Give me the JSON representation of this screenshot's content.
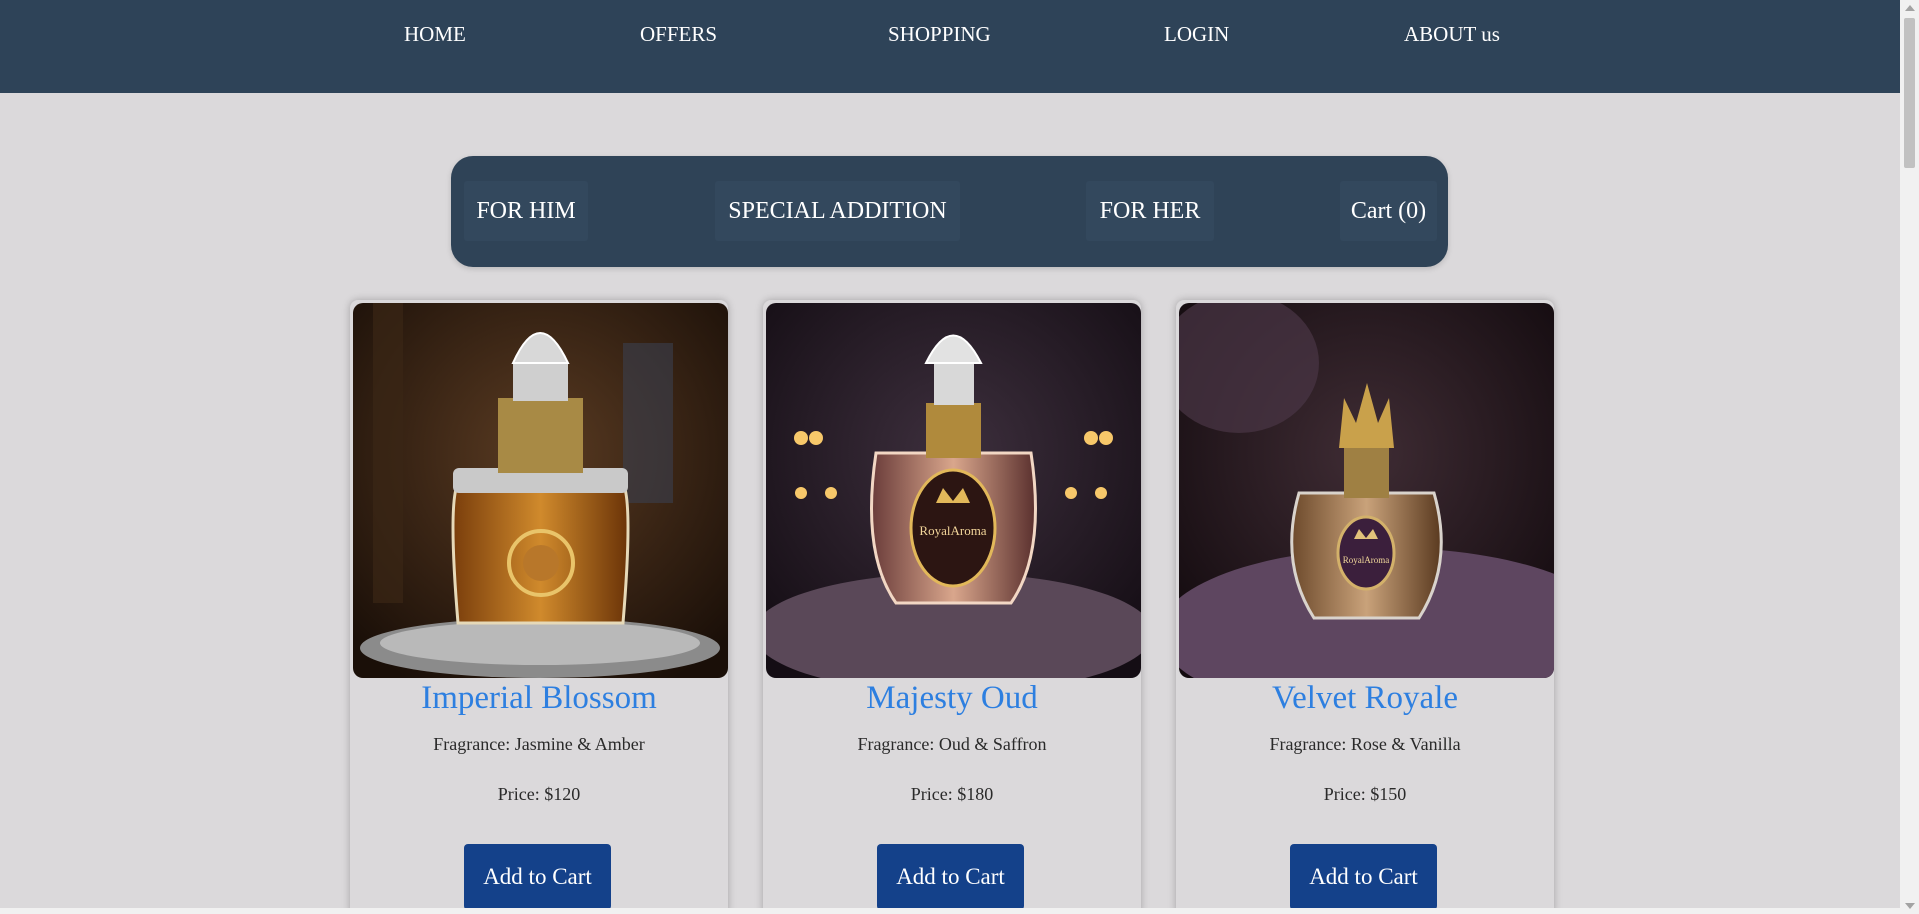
{
  "topnav": {
    "items": [
      {
        "label": "HOME"
      },
      {
        "label": "OFFERS"
      },
      {
        "label": "SHOPPING"
      },
      {
        "label": "LOGIN"
      },
      {
        "label": "ABOUT us"
      }
    ]
  },
  "categories": {
    "items": [
      {
        "label": "FOR HIM"
      },
      {
        "label": "SPECIAL ADDITION"
      },
      {
        "label": "FOR HER"
      }
    ],
    "cart_label": "Cart (0)"
  },
  "products": [
    {
      "name": "Imperial Blossom",
      "fragrance": "Fragrance: Jasmine & Amber",
      "price": "Price: $120",
      "button": "Add to Cart"
    },
    {
      "name": "Majesty Oud",
      "fragrance": "Fragrance: Oud & Saffron",
      "price": "Price: $180",
      "button": "Add to Cart",
      "bottle_text": "RoyalAroma"
    },
    {
      "name": "Velvet Royale",
      "fragrance": "Fragrance: Rose & Vanilla",
      "price": "Price: $150",
      "button": "Add to Cart",
      "bottle_text": "RoyalAroma"
    }
  ],
  "colors": {
    "nav_bg": "#2e4358",
    "page_bg": "#dbd9db",
    "product_title": "#2d7fe0",
    "button_bg": "#14418a"
  }
}
